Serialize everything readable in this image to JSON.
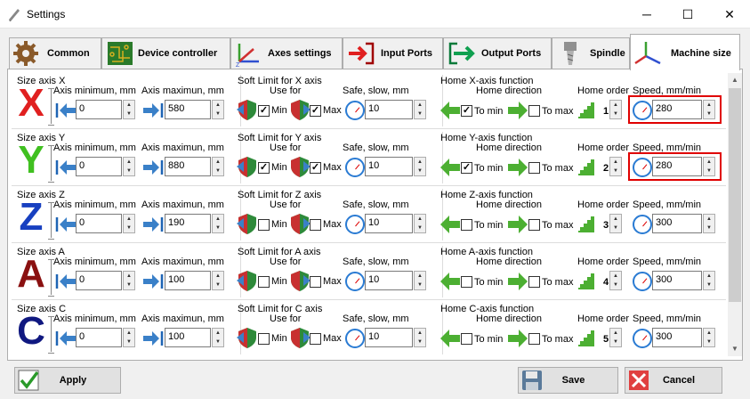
{
  "window": {
    "title": "Settings",
    "minimize": "─",
    "maximize": "☐",
    "close": "✕"
  },
  "tabs": [
    {
      "label": "Common",
      "icon": "gear-icon"
    },
    {
      "label": "Device controller",
      "icon": "circuit-board-icon"
    },
    {
      "label": "Axes settings",
      "icon": "axes-arrows-icon"
    },
    {
      "label": "Input Ports",
      "icon": "input-arrow-icon"
    },
    {
      "label": "Output Ports",
      "icon": "output-arrow-icon"
    },
    {
      "label": "Spindle",
      "icon": "spindle-icon"
    },
    {
      "label": "Machine size",
      "icon": "xyz-axes-icon",
      "active": true
    }
  ],
  "labels": {
    "axis_min": "Axis minimum, mm",
    "axis_max": "Axis maximun, mm",
    "use_for": "Use for",
    "safe_slow": "Safe, slow, mm",
    "home_direction": "Home direction",
    "home_order": "Home order",
    "speed": "Speed, mm/min",
    "min": "Min",
    "max": "Max",
    "to_min": "To min",
    "to_max": "To max"
  },
  "axes": [
    {
      "letter": "X",
      "color": "#e02020",
      "size_label": "Size axis X",
      "min": "0",
      "max": "580",
      "soft_title": "Soft Limit for X axis",
      "soft_min": true,
      "soft_max": true,
      "safe": "10",
      "home_title": "Home X-axis function",
      "to_min": true,
      "to_max": false,
      "order": "1",
      "speed": "280",
      "highlight": true
    },
    {
      "letter": "Y",
      "color": "#40c020",
      "size_label": "Size axis Y",
      "min": "0",
      "max": "880",
      "soft_title": "Soft Limit for Y axis",
      "soft_min": true,
      "soft_max": true,
      "safe": "10",
      "home_title": "Home Y-axis function",
      "to_min": true,
      "to_max": false,
      "order": "2",
      "speed": "280",
      "highlight": true
    },
    {
      "letter": "Z",
      "color": "#1840c0",
      "size_label": "Size axis Z",
      "min": "0",
      "max": "190",
      "soft_title": "Soft Limit for Z axis",
      "soft_min": false,
      "soft_max": false,
      "safe": "10",
      "home_title": "Home Z-axis function",
      "to_min": false,
      "to_max": false,
      "order": "3",
      "speed": "300",
      "highlight": false
    },
    {
      "letter": "A",
      "color": "#8a1010",
      "size_label": "Size axis A",
      "min": "0",
      "max": "100",
      "soft_title": "Soft Limit for A axis",
      "soft_min": false,
      "soft_max": false,
      "safe": "10",
      "home_title": "Home A-axis function",
      "to_min": false,
      "to_max": false,
      "order": "4",
      "speed": "300",
      "highlight": false
    },
    {
      "letter": "C",
      "color": "#101880",
      "size_label": "Size axis C",
      "min": "0",
      "max": "100",
      "soft_title": "Soft Limit for C axis",
      "soft_min": false,
      "soft_max": false,
      "safe": "10",
      "home_title": "Home C-axis function",
      "to_min": false,
      "to_max": false,
      "order": "5",
      "speed": "300",
      "highlight": false
    }
  ],
  "buttons": {
    "apply": "Apply",
    "save": "Save",
    "cancel": "Cancel"
  },
  "colors": {
    "highlight": "#e00000",
    "accent_blue": "#1e64b4",
    "arrow_green": "#4caf32",
    "arrow_red": "#e02020"
  }
}
